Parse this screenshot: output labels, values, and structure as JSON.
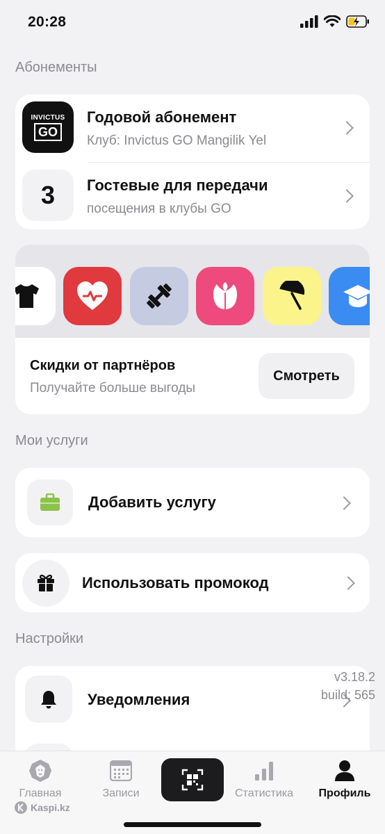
{
  "status": {
    "time": "20:28"
  },
  "subscriptions": {
    "section_title": "Абонементы",
    "items": [
      {
        "logo_top": "INVICTUS",
        "logo_bottom": "GO",
        "title": "Годовой абонемент",
        "subtitle": "Клуб: Invictus GO Mangilik Yel"
      },
      {
        "badge": "3",
        "title": "Гостевые для передачи",
        "subtitle": "посещения в клубы GO"
      }
    ]
  },
  "partners": {
    "title": "Скидки от партнёров",
    "subtitle": "Получайте больше выгоды",
    "button_label": "Смотреть",
    "tiles": [
      {
        "icon": "tshirt-icon",
        "bg": "#ffffff"
      },
      {
        "icon": "heart-pulse-icon",
        "bg": "#e0393e"
      },
      {
        "icon": "dumbbell-icon",
        "bg": "#c5cbe0"
      },
      {
        "icon": "tulip-icon",
        "bg": "#ef4a7d"
      },
      {
        "icon": "beach-umbrella-icon",
        "bg": "#fbf48a"
      },
      {
        "icon": "graduation-cap-icon",
        "bg": "#3b8cf2"
      }
    ]
  },
  "services": {
    "section_title": "Мои услуги",
    "add_label": "Добавить услугу",
    "promo_label": "Использовать промокод"
  },
  "settings": {
    "section_title": "Настройки",
    "notifications_label": "Уведомления"
  },
  "version": {
    "line1": "v3.18.2",
    "line2": "build: 565"
  },
  "tabbar": {
    "tabs": [
      "Главная",
      "Записи",
      "Статистика",
      "Профиль"
    ],
    "active": "Профиль"
  },
  "watermark": "Kaspi.kz",
  "colors": {
    "accent_green": "#8bc34a",
    "background": "#f2f2f4"
  }
}
